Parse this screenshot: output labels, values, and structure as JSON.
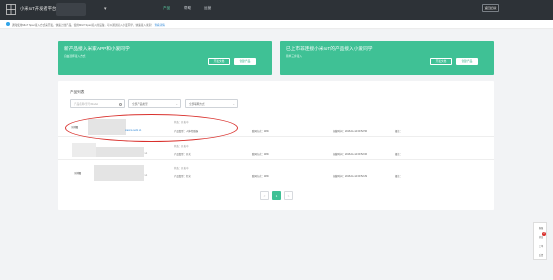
{
  "header": {
    "brand": "小米IoT开发者平台",
    "nav": [
      "产品",
      "帮助",
      "运营"
    ],
    "back_button": "返回旧版",
    "switch_indicator": "▾"
  },
  "notice": {
    "text": "通知使用MIoT Spec接入方式来开发，快速上线产品，使用MIoT Spec接入的设备，可以通过接入小爱同学，快速接入米家！",
    "link": "查看详情"
  },
  "banners": [
    {
      "title": "新产品接入米家APP和小爱同学",
      "subtitle": "自由选择接入方式",
      "primary": "创建产品",
      "secondary": "开发文档"
    },
    {
      "title": "已上市非连接小米IoT的产品接入小爱同学",
      "subtitle": "简单三步接入",
      "primary": "创建产品",
      "secondary": "开发文档"
    }
  ],
  "panel": {
    "title": "产品列表",
    "search_placeholder": "产品名称/型号/Model",
    "filters": [
      "全部产品类型",
      "全部联网方式"
    ]
  },
  "products": [
    {
      "thumb": "示例图",
      "model": "xiaomi.ceshi.v1",
      "status": "状态：开发中",
      "category": "产品类型：人体传感器",
      "connect": "联网方式：WiFi",
      "created": "创建时间：2018-11-14 09:52:56",
      "note": "备注："
    },
    {
      "thumb": "",
      "model": ".v1",
      "status": "状态：开发中",
      "category": "产品类型：开关",
      "connect": "联网方式：WiFi",
      "created": "创建时间：2018-11-14 09:52:06",
      "note": "备注："
    },
    {
      "thumb": "示例图",
      "model": ".v1",
      "status": "状态：开发中",
      "category": "产品类型：灯光",
      "connect": "联网方式：WiFi",
      "created": "创建时间：2018-11-14 09:52:29",
      "note": "备注："
    }
  ],
  "pagination": {
    "prev": "<",
    "current": "1",
    "next": ">"
  },
  "floating": {
    "items": [
      "客服",
      "消息",
      "工单",
      "反馈"
    ],
    "badge": "2"
  },
  "colors": {
    "accent": "#3fc195",
    "topbar": "#2d3237",
    "link": "#2e86d6",
    "highlight": "#d9302c"
  }
}
